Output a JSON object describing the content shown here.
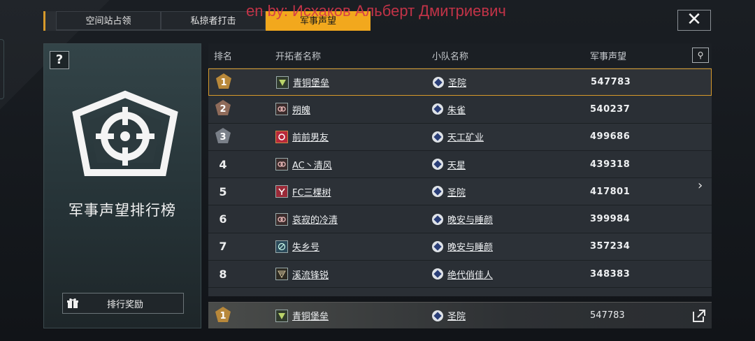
{
  "tabs": [
    {
      "label": "空间站占领",
      "active": false
    },
    {
      "label": "私掠者打击",
      "active": false
    },
    {
      "label": "军事声望",
      "active": true
    }
  ],
  "watermark": "en by:  Исхаков Альберт Дмитриевич",
  "close_label": "✕",
  "left_panel": {
    "help_label": "?",
    "title": "军事声望排行榜",
    "reward_button": "排行奖励"
  },
  "table": {
    "headers": {
      "rank": "排名",
      "founder": "开拓者名称",
      "team": "小队名称",
      "score": "军事声望"
    },
    "rows": [
      {
        "rank": "1",
        "founder": "青铜堡垒",
        "team": "圣院",
        "score": "547783"
      },
      {
        "rank": "2",
        "founder": "朔魄",
        "team": "朱雀",
        "score": "540237"
      },
      {
        "rank": "3",
        "founder": "前前男友",
        "team": "天工矿业",
        "score": "499686"
      },
      {
        "rank": "4",
        "founder": "AC丶清风",
        "team": "天星",
        "score": "439318"
      },
      {
        "rank": "5",
        "founder": "FC三棵树",
        "team": "圣院",
        "score": "417801"
      },
      {
        "rank": "6",
        "founder": "哀寂的冷清",
        "team": "晚安与睡颜",
        "score": "399984"
      },
      {
        "rank": "7",
        "founder": "失乡号",
        "team": "晚安与睡颜",
        "score": "357234"
      },
      {
        "rank": "8",
        "founder": "溪流锋锐",
        "team": "绝代俏佳人",
        "score": "348383"
      }
    ],
    "self": {
      "rank": "1",
      "founder": "青铜堡垒",
      "team": "圣院",
      "score": "547783"
    }
  },
  "colors": {
    "accent": "#f2a81d",
    "gold_border": "#d79a2b",
    "watermark": "#d4364c"
  },
  "icons": {
    "close": "close-icon",
    "help": "help-icon",
    "filter": "pin-icon",
    "share": "share-icon",
    "gift": "gift-icon",
    "next": "chevron-right-icon",
    "more": "chevron-down-icon"
  }
}
